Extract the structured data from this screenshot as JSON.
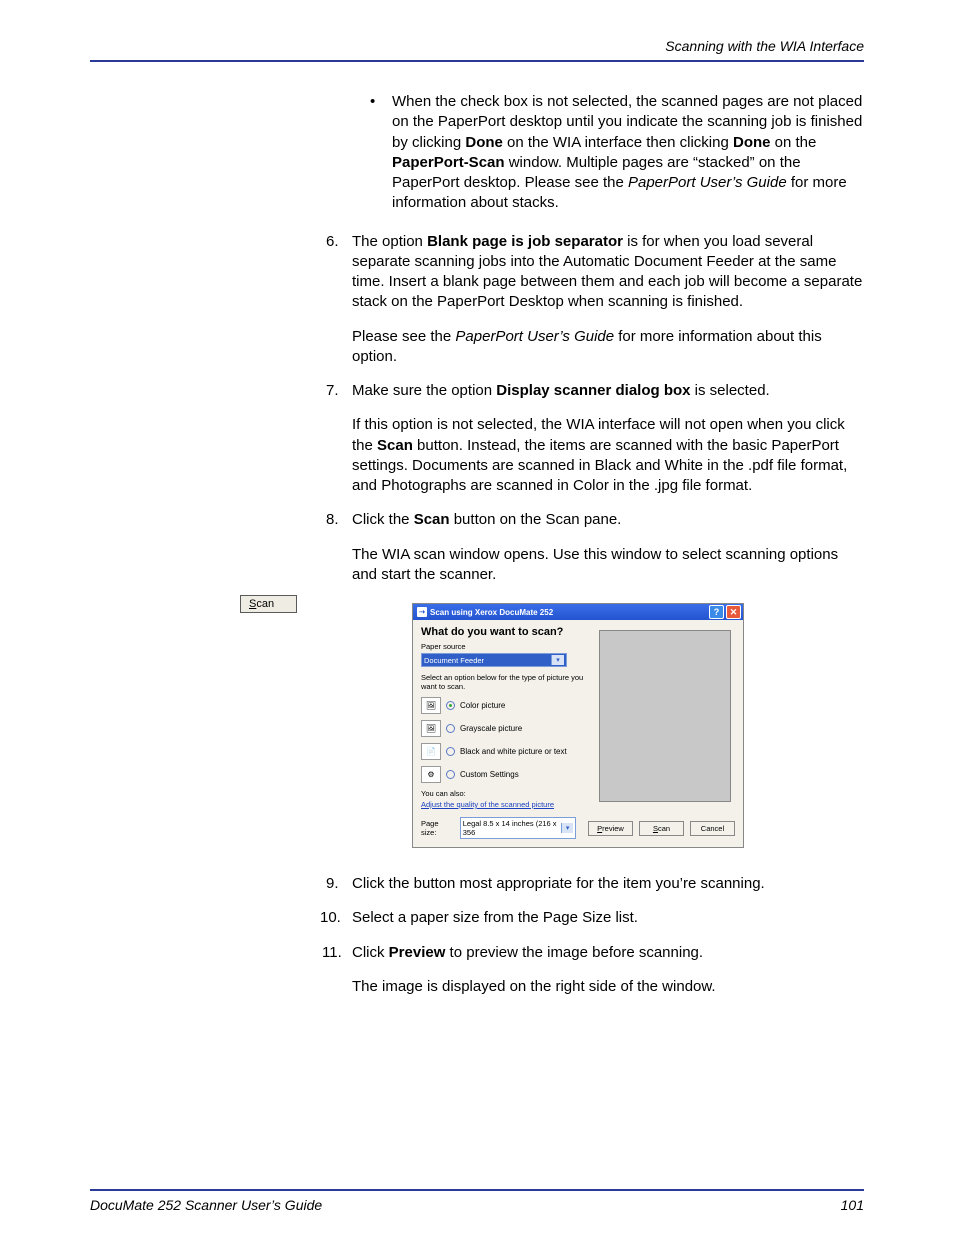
{
  "header": {
    "section_title": "Scanning with the WIA Interface"
  },
  "footer": {
    "book_title": "DocuMate 252 Scanner User’s Guide",
    "page_number": "101"
  },
  "margin": {
    "scan_button_label": "Scan"
  },
  "body": {
    "bullet_a": "When the check box is not selected, the scanned pages are not placed on the PaperPort desktop until you indicate the scanning job is finished by clicking ",
    "bullet_b": "Done",
    "bullet_c": " on the WIA interface then clicking ",
    "bullet_d": "Done",
    "bullet_e": " on the ",
    "bullet_f": "PaperPort-Scan",
    "bullet_g": " window. Multiple pages are “stacked” on the PaperPort desktop. Please see the ",
    "bullet_h": "PaperPort User’s Guide",
    "bullet_i": " for more information about stacks.",
    "n6_num": "6.",
    "n6_a": "The option ",
    "n6_b": "Blank page is job separator",
    "n6_c": " is for when you load several separate scanning jobs into the Automatic Document Feeder at the same time. Insert a blank page between them and each job will become a separate stack on the PaperPort Desktop when scanning is finished.",
    "n6_p2a": "Please see the ",
    "n6_p2b": "PaperPort User’s Guide",
    "n6_p2c": " for more information about this option.",
    "n7_num": "7.",
    "n7_a": "Make sure the option ",
    "n7_b": "Display scanner dialog box",
    "n7_c": " is selected.",
    "n7_p2a": "If this option is not selected, the WIA interface will not open when you click the ",
    "n7_p2b": "Scan",
    "n7_p2c": " button. Instead, the items are scanned with the basic PaperPort settings. Documents are scanned in Black and White in the .pdf file format, and Photographs are scanned in Color in the .jpg file format.",
    "n8_num": "8.",
    "n8_a": "Click the ",
    "n8_b": "Scan",
    "n8_c": " button on the Scan pane.",
    "n8_p2": "The WIA scan window opens. Use this window to select scanning options and start the scanner.",
    "n9_num": "9.",
    "n9_t": "Click the button most appropriate for the item you’re scanning.",
    "n10_num": "10.",
    "n10_t": "Select a paper size from the Page Size list.",
    "n11_num": "11.",
    "n11_a": "Click ",
    "n11_b": "Preview",
    "n11_c": " to preview the image before scanning.",
    "n11_p2": "The image is displayed on the right side of the window."
  },
  "dialog": {
    "title": "Scan using Xerox DocuMate 252",
    "question": "What do you want to scan?",
    "paper_source_label": "Paper source",
    "paper_source_value": "Document Feeder",
    "instruction": "Select an option below for the type of picture you want to scan.",
    "opt_color": "Color picture",
    "opt_gray": "Grayscale picture",
    "opt_bw": "Black and white picture or text",
    "opt_custom": "Custom Settings",
    "also_label": "You can also:",
    "adjust_link": "Adjust the quality of the scanned picture",
    "page_size_label": "Page size:",
    "page_size_value": "Legal 8.5 x 14 inches (216 x 356",
    "btn_preview": "Preview",
    "btn_scan": "Scan",
    "btn_cancel": "Cancel"
  }
}
